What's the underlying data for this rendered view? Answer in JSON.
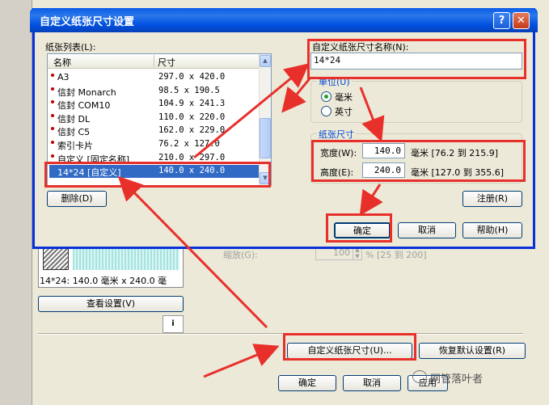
{
  "dialog": {
    "title": "自定义纸张尺寸设置",
    "help_btn": "?",
    "close_btn": "✕",
    "paper_list_label": "纸张列表(L):",
    "col_name": "名称",
    "col_size": "尺寸",
    "papers": [
      {
        "name": "A3",
        "size": "297.0 x 420.0"
      },
      {
        "name": "信封 Monarch",
        "size": "98.5 x 190.5"
      },
      {
        "name": "信封 COM10",
        "size": "104.9 x 241.3"
      },
      {
        "name": "信封 DL",
        "size": "110.0 x 220.0"
      },
      {
        "name": "信封 C5",
        "size": "162.0 x 229.0"
      },
      {
        "name": "索引卡片",
        "size": "76.2 x 127.0"
      },
      {
        "name": "自定义 [固定名称]",
        "size": "210.0 x 297.0"
      },
      {
        "name": "14*24 [自定义]",
        "size": "140.0 x 240.0"
      }
    ],
    "delete_btn": "删除(D)",
    "custom_name_label": "自定义纸张尺寸名称(N):",
    "custom_name_value": "14*24",
    "unit_label": "单位(U)",
    "unit_mm": "毫米",
    "unit_inch": "英寸",
    "paper_size_label": "纸张尺寸",
    "width_label": "宽度(W):",
    "width_value": "140.0",
    "width_range": "毫米 [76.2 到 215.9]",
    "height_label": "高度(E):",
    "height_value": "240.0",
    "height_range": "毫米 [127.0 到 355.6]",
    "register_btn": "注册(R)",
    "ok_btn": "确定",
    "cancel_btn": "取消",
    "help_btn2": "帮助(H)"
  },
  "background": {
    "preview_text": "14*24: 140.0 毫米 x 240.0 毫",
    "scale_label": "缩放(G):",
    "scale_value": "100",
    "scale_range": "% [25 到 200]",
    "view_settings_btn": "查看设置(V)",
    "custom_size_btn": "自定义纸张尺寸(U)...",
    "restore_default_btn": "恢复默认设置(R)",
    "ok_btn": "确定",
    "cancel_btn": "取消",
    "apply_btn": "应用"
  },
  "watermark": "网管落叶者",
  "colors": {
    "highlight_box": "#e8302b",
    "selection": "#316ac5",
    "titlebar": "#0a5ae8"
  }
}
